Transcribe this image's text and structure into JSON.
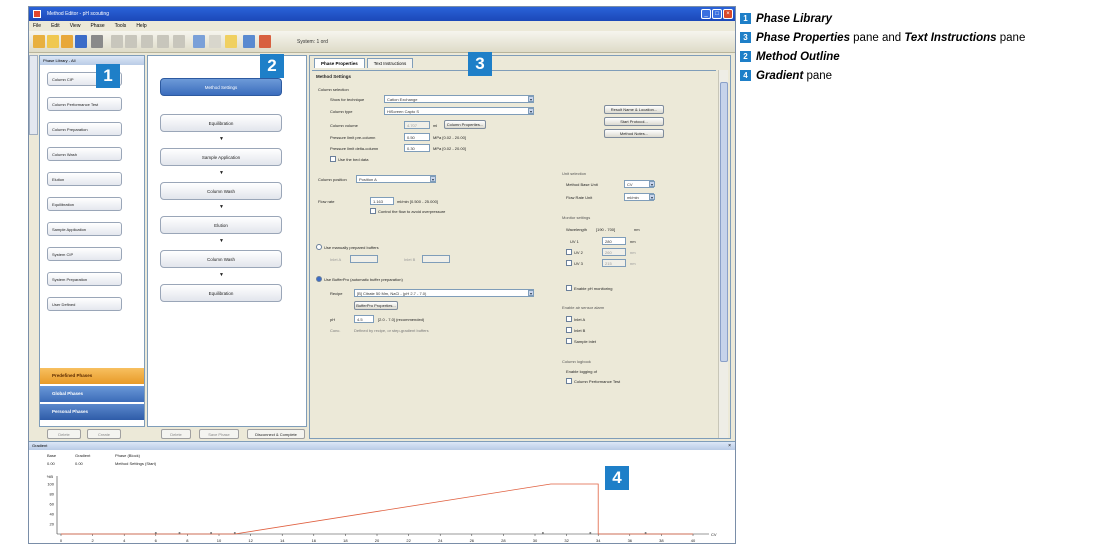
{
  "window": {
    "title": "Method Editor - pH scouting",
    "menu": [
      "File",
      "Edit",
      "View",
      "Phase",
      "Tools",
      "Help"
    ],
    "toolbar_status": "System: 1 ord"
  },
  "phase_library": {
    "header": "Phase Library - All",
    "items": [
      "Column CIP",
      "Column Performance Test",
      "Column Preparation",
      "Column Wash",
      "Elution",
      "Equilibration",
      "Sample Application",
      "System CIP",
      "System Preparation",
      "User Defined"
    ],
    "categories": [
      "Predefined Phases",
      "Global Phases",
      "Personal Phases"
    ],
    "buttons": [
      "Delete",
      "Create"
    ]
  },
  "method_outline": {
    "steps": [
      "Method Settings",
      "Equilibration",
      "Sample Application",
      "Column Wash",
      "Elution",
      "Column Wash",
      "Equilibration"
    ],
    "arrow": "▼",
    "buttons": [
      "Delete",
      "Save Phase",
      "Disconnect & Complete"
    ]
  },
  "phase_properties": {
    "tabs": [
      "Phase Properties",
      "Text Instructions"
    ],
    "title": "Method Settings",
    "column_selection": {
      "label": "Column selection",
      "technique_label": "Show for technique",
      "technique_value": "Cation Exchange",
      "column_type_label": "Column type",
      "column_type_value": "HiScreen Capto S",
      "column_volume_label": "Column volume",
      "column_volume_value": "4.707",
      "column_volume_unit": "ml",
      "column_properties_button": "Column Properties...",
      "pressure_limit_label": "Pressure limit pre-column",
      "pressure_limit_value": "0.50",
      "pressure_limit_unit": "MPa [0.02 - 20.00]",
      "delta_limit_label": "Pressure limit delta-column",
      "delta_limit_value": "0.30",
      "delta_limit_unit": "MPa [0.02 - 20.00]",
      "use_bed_label": "Use the bed data"
    },
    "column_position_label": "Column position",
    "column_position_value": "Position A",
    "flow_rate_label": "Flow rate",
    "flow_rate_value": "1.163",
    "flow_rate_unit": "ml/min [0.500 - 25.000]",
    "control_flow_label": "Control the flow to avoid overpressure",
    "radio_manual": "Use manually prepared buffers",
    "inlet_a": "Inlet A",
    "inlet_b": "Inlet B",
    "radio_bufferpro": "Use BufferPro (automatic buffer preparation)",
    "recipe_label": "Recipe",
    "recipe_value": "[B] Citrate 50 Mm, NaCl - (pH 2.7 - 7.0)",
    "bufferpro_button": "BufferPro Properties...",
    "ph_label": "pH",
    "ph_value": "4.5",
    "ph_range": "[2.0 - 7.0] (recommended)",
    "conc_label": "Conc.",
    "conc_value": "Defined by recipe, or step-gradient buffers",
    "result_button": "Result Name & Location...",
    "start_protocol_button": "Start Protocol...",
    "method_notes_button": "Method Notes...",
    "unit_selection_label": "Unit selection",
    "method_base_label": "Method Base Unit",
    "method_base_value": "CV",
    "flow_unit_label": "Flow Rate Unit",
    "flow_unit_value": "ml/min",
    "monitor_label": "Monitor settings",
    "wavelength_label": "Wavelength",
    "wavelength_range": "[190 - 700]",
    "wavelength_unit": "nm",
    "uv1_label": "UV 1",
    "uv1_value": "280",
    "uv2_label": "UV 2",
    "uv2_value": "260",
    "uv3_label": "UV 3",
    "uv3_value": "215",
    "ph_monitoring_label": "Enable pH monitoring",
    "enable_air_label": "Enable air sensor alarm",
    "inlet_a_chk": "Inlet A",
    "inlet_b_chk": "Inlet B",
    "sample_inlet_chk": "Sample inlet",
    "column_logbook_label": "Column logbook",
    "enable_logging_label": "Enable logging of",
    "column_perf_test_label": "Column Performance Test"
  },
  "gradient": {
    "header": "Gradient",
    "columns": [
      "Base",
      "Gradient",
      "Phase (Block)"
    ],
    "row": [
      "0.00",
      "0.00",
      "Method Settings (Start)"
    ],
    "y_ticks": [
      "100",
      "80",
      "60",
      "40",
      "20"
    ],
    "y_top": "%B",
    "x_ticks": [
      "0",
      "2",
      "4",
      "6",
      "8",
      "10",
      "12",
      "14",
      "16",
      "18",
      "20",
      "22",
      "24",
      "26",
      "28",
      "30",
      "32",
      "34",
      "36",
      "38",
      "40"
    ],
    "x_unit": "CV"
  },
  "callouts": [
    "1",
    "2",
    "3",
    "4"
  ],
  "legend": [
    {
      "num": "1",
      "bold": "Phase Library",
      "rest": ""
    },
    {
      "num": "3",
      "bold": "Phase Properties",
      "mid": " pane and ",
      "bold2": "Text Instructions",
      "rest": " pane"
    },
    {
      "num": "2",
      "bold": "Method Outline",
      "rest": ""
    },
    {
      "num": "4",
      "bold": "Gradient",
      "rest": " pane"
    }
  ],
  "colors": {
    "callout": "#1e7fc8",
    "predefined": "#f0a030",
    "global": "#4a7cc4",
    "personal": "#3a66b0",
    "gradient_line": "#e06040"
  }
}
